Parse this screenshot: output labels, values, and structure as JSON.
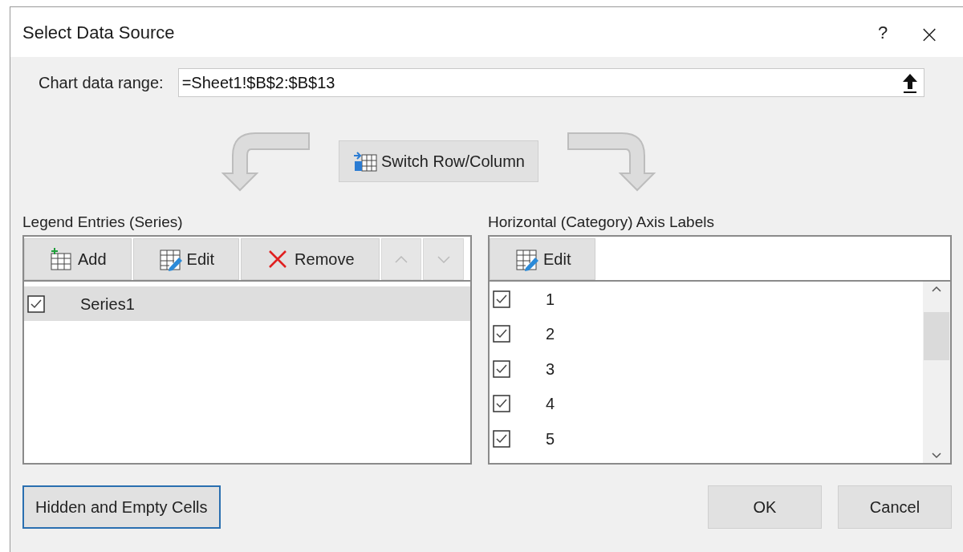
{
  "window": {
    "title": "Select Data Source",
    "help": "?",
    "close": "×"
  },
  "data_range": {
    "label": "Chart data range:",
    "value": "=Sheet1!$B$2:$B$13"
  },
  "switch_button": {
    "label": "Switch Row/Column"
  },
  "series_panel": {
    "title": "Legend Entries (Series)",
    "toolbar": [
      {
        "kind": "add",
        "label": "Add",
        "disabled": false
      },
      {
        "kind": "edit",
        "label": "Edit",
        "disabled": false
      },
      {
        "kind": "remove",
        "label": "Remove",
        "disabled": false
      },
      {
        "kind": "up",
        "disabled": true
      },
      {
        "kind": "down",
        "disabled": true
      }
    ],
    "items": [
      {
        "label": "Series1",
        "checked": true,
        "selected": true
      }
    ]
  },
  "category_panel": {
    "title": "Horizontal (Category) Axis Labels",
    "toolbar": [
      {
        "kind": "edit",
        "label": "Edit",
        "disabled": false
      }
    ],
    "items": [
      {
        "label": "1",
        "checked": true,
        "selected": false
      },
      {
        "label": "2",
        "checked": true,
        "selected": false
      },
      {
        "label": "3",
        "checked": true,
        "selected": false
      },
      {
        "label": "4",
        "checked": true,
        "selected": false
      },
      {
        "label": "5",
        "checked": true,
        "selected": false
      }
    ]
  },
  "footer": [
    {
      "kind": "hidden",
      "label": "Hidden and Empty Cells",
      "focused": true
    },
    {
      "kind": "ok",
      "label": "OK",
      "focused": false
    },
    {
      "kind": "cancel",
      "label": "Cancel",
      "focused": false
    }
  ]
}
